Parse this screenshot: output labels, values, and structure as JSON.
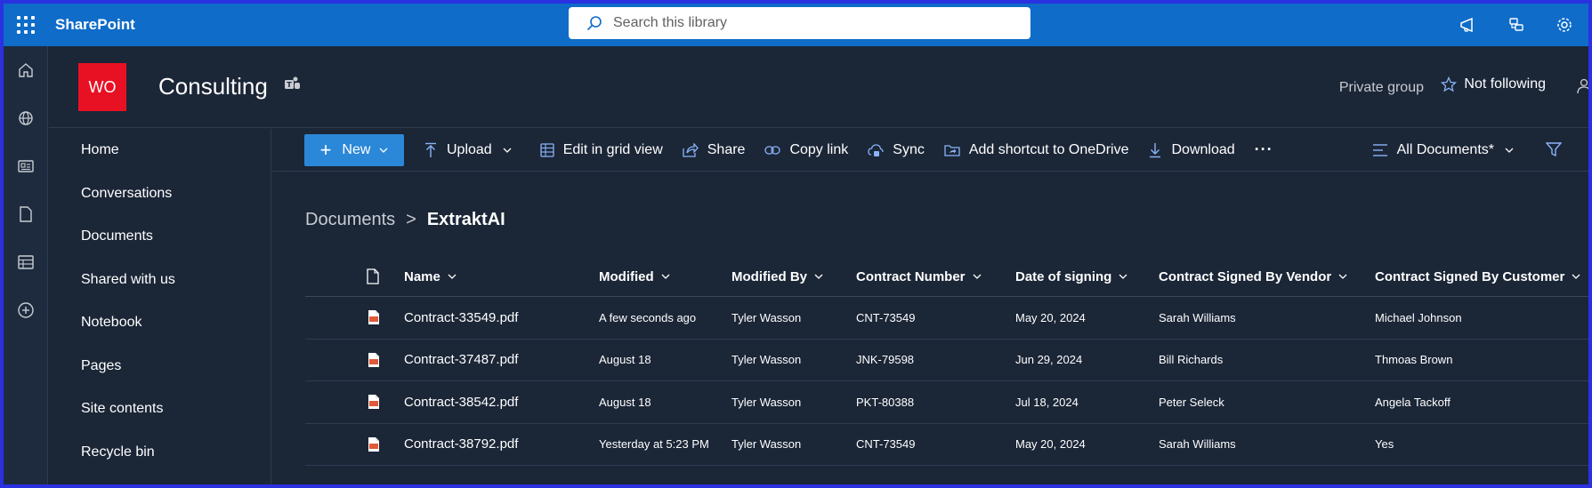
{
  "suite": {
    "brand": "SharePoint",
    "search_placeholder": "Search this library"
  },
  "site": {
    "logo_initials": "WO",
    "title": "Consulting",
    "privacy": "Private group",
    "follow_label": "Not following"
  },
  "nav": {
    "items": [
      "Home",
      "Conversations",
      "Documents",
      "Shared with us",
      "Notebook",
      "Pages",
      "Site contents",
      "Recycle bin"
    ]
  },
  "commands": {
    "new": "New",
    "upload": "Upload",
    "edit_grid": "Edit in grid view",
    "share": "Share",
    "copy_link": "Copy link",
    "sync": "Sync",
    "add_shortcut": "Add shortcut to OneDrive",
    "download": "Download",
    "more": "···",
    "view": "All Documents*"
  },
  "breadcrumb": {
    "parent": "Documents",
    "separator": ">",
    "current": "ExtraktAI"
  },
  "table": {
    "columns": {
      "name": "Name",
      "modified": "Modified",
      "modified_by": "Modified By",
      "contract_number": "Contract Number",
      "date_signing": "Date of signing",
      "signed_vendor": "Contract Signed By Vendor",
      "signed_customer": "Contract Signed By Customer"
    },
    "rows": [
      {
        "name": "Contract-33549.pdf",
        "modified": "A few seconds ago",
        "modified_by": "Tyler Wasson",
        "contract_number": "CNT-73549",
        "date_signing": "May 20, 2024",
        "signed_vendor": "Sarah Williams",
        "signed_customer": "Michael Johnson"
      },
      {
        "name": "Contract-37487.pdf",
        "modified": "August 18",
        "modified_by": "Tyler Wasson",
        "contract_number": "JNK-79598",
        "date_signing": "Jun 29, 2024",
        "signed_vendor": "Bill Richards",
        "signed_customer": "Thmoas Brown"
      },
      {
        "name": "Contract-38542.pdf",
        "modified": "August 18",
        "modified_by": "Tyler Wasson",
        "contract_number": "PKT-80388",
        "date_signing": "Jul 18, 2024",
        "signed_vendor": "Peter Seleck",
        "signed_customer": "Angela Tackoff"
      },
      {
        "name": "Contract-38792.pdf",
        "modified": "Yesterday at 5:23 PM",
        "modified_by": "Tyler Wasson",
        "contract_number": "CNT-73549",
        "date_signing": "May 20, 2024",
        "signed_vendor": "Sarah Williams",
        "signed_customer": "Yes"
      }
    ]
  },
  "colors": {
    "suitebar": "#0f6cc8",
    "background": "#1b2637",
    "accent": "#2b88d8",
    "logo": "#e81123",
    "pdf": "#e05a3a"
  }
}
